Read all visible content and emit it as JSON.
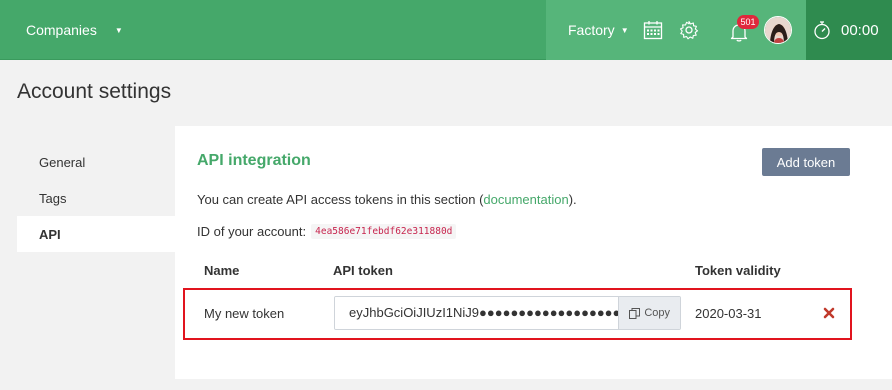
{
  "topbar": {
    "companies_label": "Companies",
    "factory_label": "Factory",
    "notification_count": "501",
    "timer": "00:00"
  },
  "page": {
    "title": "Account settings"
  },
  "sidebar": {
    "items": [
      {
        "label": "General"
      },
      {
        "label": "Tags"
      },
      {
        "label": "API",
        "active": true
      }
    ]
  },
  "main": {
    "section_title": "API integration",
    "add_token_label": "Add token",
    "info_prefix": "You can create API access tokens in this section (",
    "info_link": "documentation",
    "info_suffix": ").",
    "account_id_label": "ID of your account:",
    "account_id": "4ea586e71febdf62e311880d",
    "table": {
      "headers": {
        "name": "Name",
        "token": "API token",
        "validity": "Token validity"
      },
      "rows": [
        {
          "name": "My new token",
          "token": "eyJhbGciOiJIUzI1NiJ9●●●●●●●●●●●●●●●●●●●",
          "copy_label": "Copy",
          "validity": "2020-03-31"
        }
      ]
    }
  },
  "colors": {
    "brand_green": "#45a86a",
    "highlight_red": "#e1141e",
    "delete_red": "#c0392b",
    "button_slate": "#6b7b93"
  }
}
